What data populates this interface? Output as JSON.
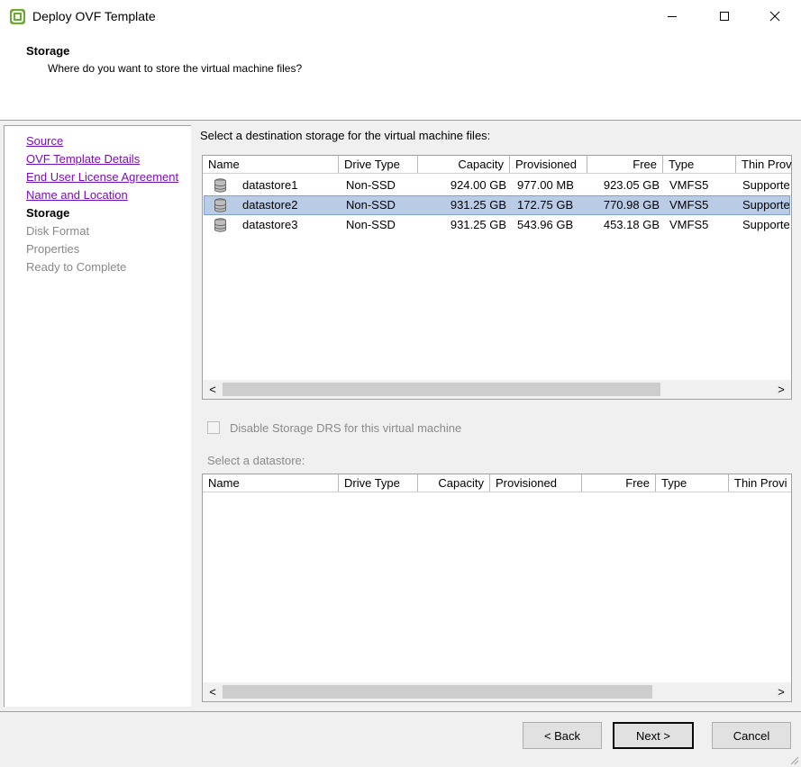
{
  "window": {
    "title": "Deploy OVF Template",
    "controls": {
      "minimize": "—",
      "maximize": "☐",
      "close": "✕"
    }
  },
  "header": {
    "title": "Storage",
    "subtitle": "Where do you want to store the virtual machine files?"
  },
  "nav": {
    "items": [
      {
        "label": "Source",
        "state": "link"
      },
      {
        "label": "OVF Template Details",
        "state": "link"
      },
      {
        "label": "End User License Agreement",
        "state": "link"
      },
      {
        "label": "Name and Location",
        "state": "link"
      },
      {
        "label": "Storage",
        "state": "current"
      },
      {
        "label": "Disk Format",
        "state": "disabled"
      },
      {
        "label": "Properties",
        "state": "disabled"
      },
      {
        "label": "Ready to Complete",
        "state": "disabled"
      }
    ]
  },
  "main": {
    "prompt": "Select a destination storage for the virtual machine files:",
    "columns": [
      "Name",
      "Drive Type",
      "Capacity",
      "Provisioned",
      "Free",
      "Type",
      "Thin Prov"
    ],
    "rows": [
      {
        "name": "datastore1",
        "drive_type": "Non-SSD",
        "capacity": "924.00 GB",
        "provisioned": "977.00 MB",
        "free": "923.05 GB",
        "type": "VMFS5",
        "thin": "Supporte",
        "selected": false
      },
      {
        "name": "datastore2",
        "drive_type": "Non-SSD",
        "capacity": "931.25 GB",
        "provisioned": "172.75 GB",
        "free": "770.98 GB",
        "type": "VMFS5",
        "thin": "Supporte",
        "selected": true
      },
      {
        "name": "datastore3",
        "drive_type": "Non-SSD",
        "capacity": "931.25 GB",
        "provisioned": "543.96 GB",
        "free": "453.18 GB",
        "type": "VMFS5",
        "thin": "Supporte",
        "selected": false
      }
    ],
    "drs_checkbox": {
      "label": "Disable Storage DRS for this virtual machine",
      "checked": false,
      "enabled": false
    },
    "select_datastore_label": "Select a datastore:",
    "columns2": [
      "Name",
      "Drive Type",
      "Capacity",
      "Provisioned",
      "Free",
      "Type",
      "Thin Provi"
    ],
    "scroll": {
      "left": "<",
      "right": ">"
    }
  },
  "footer": {
    "back_label": "< Back",
    "next_label": "Next >",
    "cancel_label": "Cancel"
  },
  "colors": {
    "link": "#7a0db8",
    "selection": "#b9cbe5",
    "panel": "#f0f0f0",
    "app_icon": "#6fa835"
  },
  "icons": [
    "vsphere-app-icon",
    "datastore-icon",
    "minimize-icon",
    "maximize-icon",
    "close-icon",
    "resize-grip-icon"
  ]
}
